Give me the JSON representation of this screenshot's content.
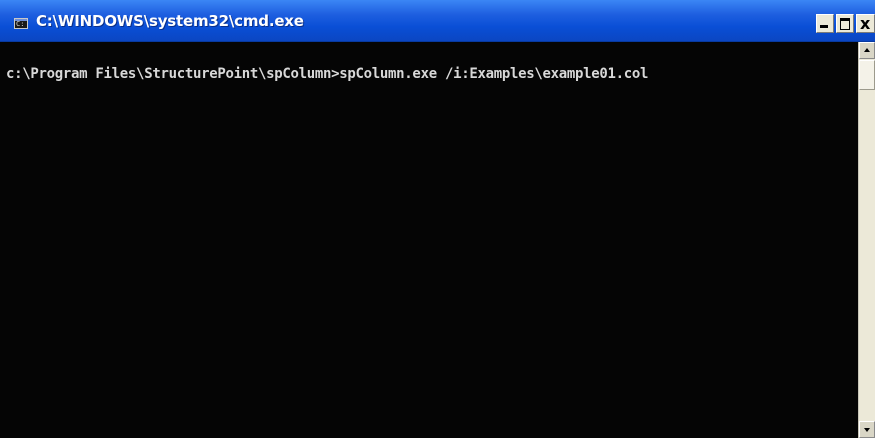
{
  "window": {
    "title": "C:\\WINDOWS\\system32\\cmd.exe",
    "icon": "cmd-icon",
    "controls": {
      "minimize_icon": "minimize-icon",
      "maximize_icon": "maximize-icon",
      "close_label": "x"
    }
  },
  "console": {
    "lines": [
      "c:\\Program Files\\StructurePoint\\spColumn>spColumn.exe /i:Examples\\example01.col"
    ],
    "text_color": "#d8d8d8",
    "background": "#050505"
  },
  "scrollbar": {
    "up_icon": "scroll-up-arrow-icon",
    "down_icon": "scroll-down-arrow-icon"
  },
  "colors": {
    "titlebar": "#0a4fd6",
    "title_text": "#ffffff"
  }
}
